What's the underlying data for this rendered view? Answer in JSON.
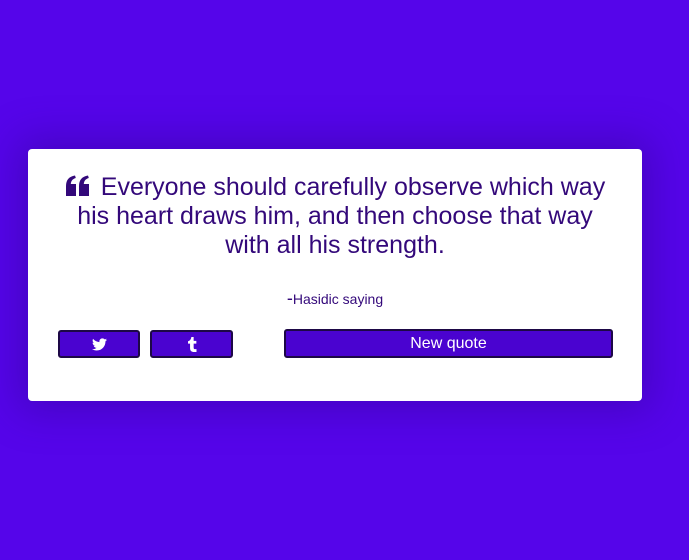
{
  "quote": {
    "text": "Everyone should carefully observe which way his heart draws him, and then choose that way with all his strength.",
    "author_dash": "-",
    "author": "Hasidic saying",
    "icon": "quote-left-icon"
  },
  "buttons": {
    "twitter_icon": "twitter-icon",
    "tumblr_icon": "tumblr-icon",
    "new_quote_label": "New quote"
  },
  "colors": {
    "background": "#5505ea",
    "card": "#ffffff",
    "text": "#33087a",
    "button": "#4a03d0",
    "button_border": "#1d0846"
  }
}
